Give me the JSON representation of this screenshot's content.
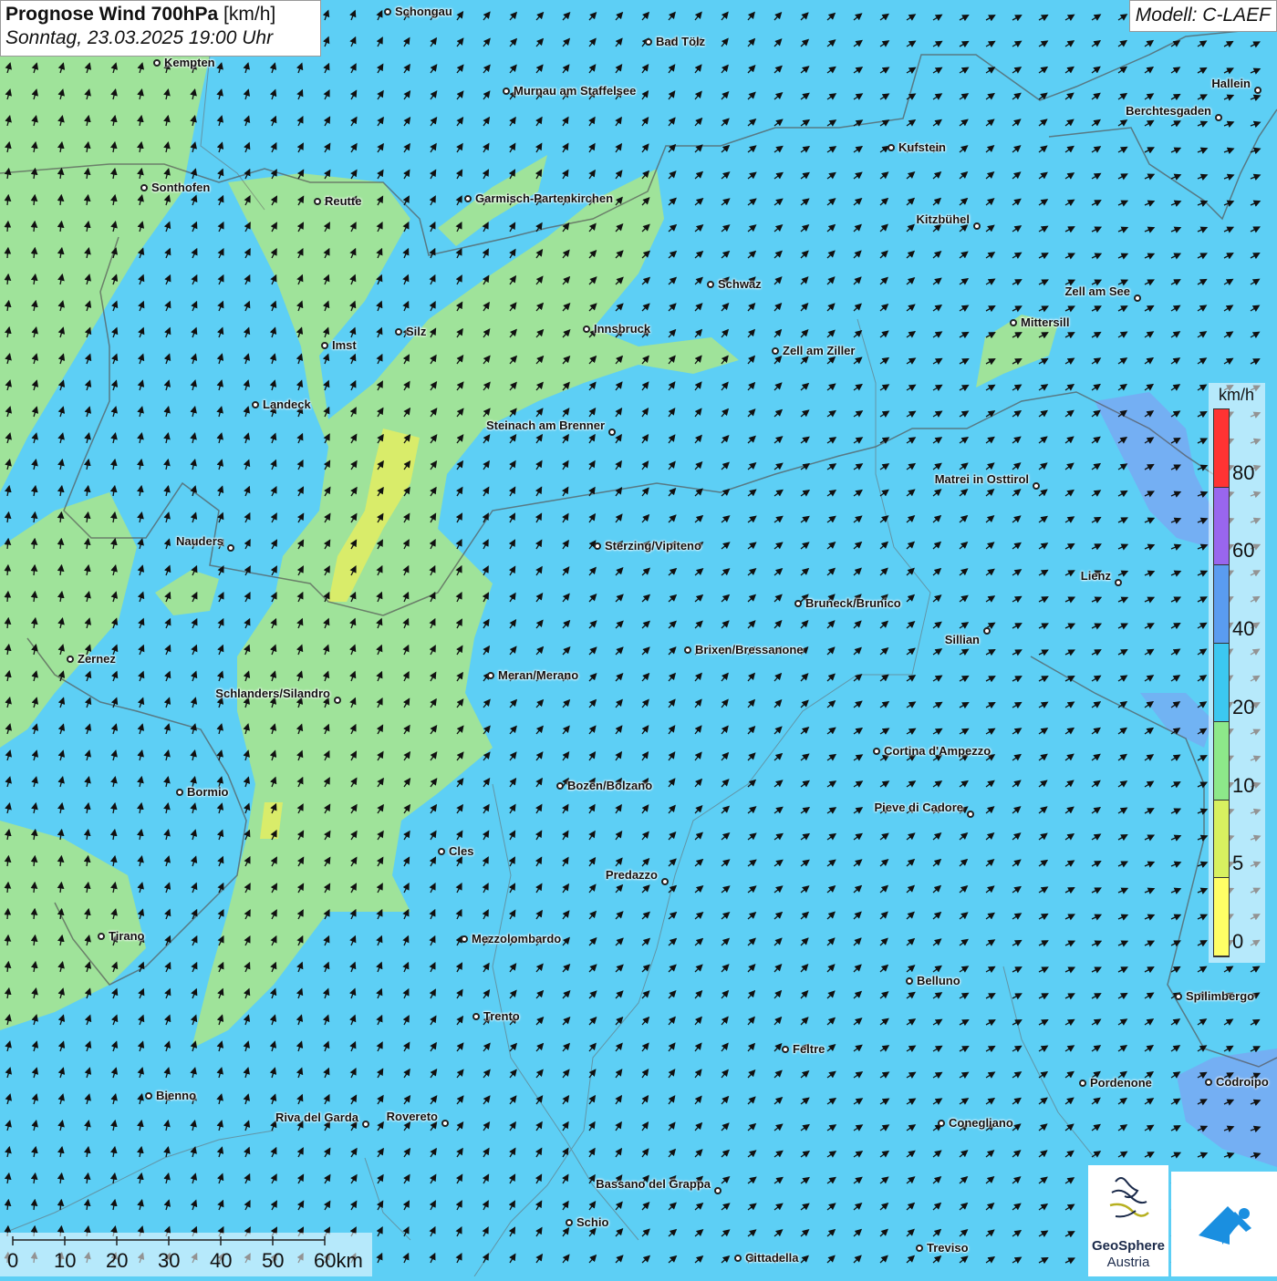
{
  "header": {
    "title_bold": "Prognose Wind 700hPa",
    "title_unit": "[km/h]",
    "datetime": "Sonntag, 23.03.2025 19:00 Uhr",
    "model": "Modell: C-LAEF"
  },
  "legend": {
    "unit": "km/h",
    "bins": [
      {
        "label": "0",
        "color": "#ffff66"
      },
      {
        "label": "5",
        "color": "#d8f060"
      },
      {
        "label": "10",
        "color": "#8de88a"
      },
      {
        "label": "20",
        "color": "#3cc8f0"
      },
      {
        "label": "40",
        "color": "#5a9cf0"
      },
      {
        "label": "60",
        "color": "#9966ee"
      },
      {
        "label": "80",
        "color": "#ff3333"
      }
    ]
  },
  "scale": {
    "labels": [
      "0",
      "10",
      "20",
      "30",
      "40",
      "50",
      "60km"
    ]
  },
  "logos": {
    "geosphere_line1": "GeoSphere",
    "geosphere_line2": "Austria"
  },
  "colors": {
    "background_wind": "#5dcff5",
    "low_wind": "#9fe39a",
    "very_low_wind": "#d9ec6a",
    "stronger_wind": "#7aa6f2"
  },
  "cities": [
    {
      "name": "Schongau"
    },
    {
      "name": "Bad Tölz"
    },
    {
      "name": "Kempten"
    },
    {
      "name": "Murnau am Staffelsee"
    },
    {
      "name": "Hallein"
    },
    {
      "name": "Berchtesgaden"
    },
    {
      "name": "Kufstein"
    },
    {
      "name": "Sonthofen"
    },
    {
      "name": "Reutte"
    },
    {
      "name": "Garmisch-Partenkirchen"
    },
    {
      "name": "Kitzbühel"
    },
    {
      "name": "Schwaz"
    },
    {
      "name": "Zell am See"
    },
    {
      "name": "Mittersill"
    },
    {
      "name": "Imst"
    },
    {
      "name": "Silz"
    },
    {
      "name": "Innsbruck"
    },
    {
      "name": "Zell am Ziller"
    },
    {
      "name": "Landeck"
    },
    {
      "name": "Steinach am Brenner"
    },
    {
      "name": "Matrei in Osttirol"
    },
    {
      "name": "Nauders"
    },
    {
      "name": "Sterzing/Vipiteno"
    },
    {
      "name": "Lienz"
    },
    {
      "name": "Bruneck/Brunico"
    },
    {
      "name": "Sillian"
    },
    {
      "name": "Brixen/Bressanone"
    },
    {
      "name": "Zernez"
    },
    {
      "name": "Meran/Merano"
    },
    {
      "name": "Schlanders/Silandro"
    },
    {
      "name": "Cortina d'Ampezzo"
    },
    {
      "name": "Bozen/Bolzano"
    },
    {
      "name": "Bormio"
    },
    {
      "name": "Pieve di Cadore"
    },
    {
      "name": "Cles"
    },
    {
      "name": "Predazzo"
    },
    {
      "name": "Tirano"
    },
    {
      "name": "Mezzolombardo"
    },
    {
      "name": "Belluno"
    },
    {
      "name": "Spilimbergo"
    },
    {
      "name": "Trento"
    },
    {
      "name": "Feltre"
    },
    {
      "name": "Bienno"
    },
    {
      "name": "Pordenone"
    },
    {
      "name": "Codroipo"
    },
    {
      "name": "Riva del Garda"
    },
    {
      "name": "Rovereto"
    },
    {
      "name": "Conegliano"
    },
    {
      "name": "Bassano del Grappa"
    },
    {
      "name": "Schio"
    },
    {
      "name": "Treviso"
    },
    {
      "name": "Cittadella"
    }
  ]
}
